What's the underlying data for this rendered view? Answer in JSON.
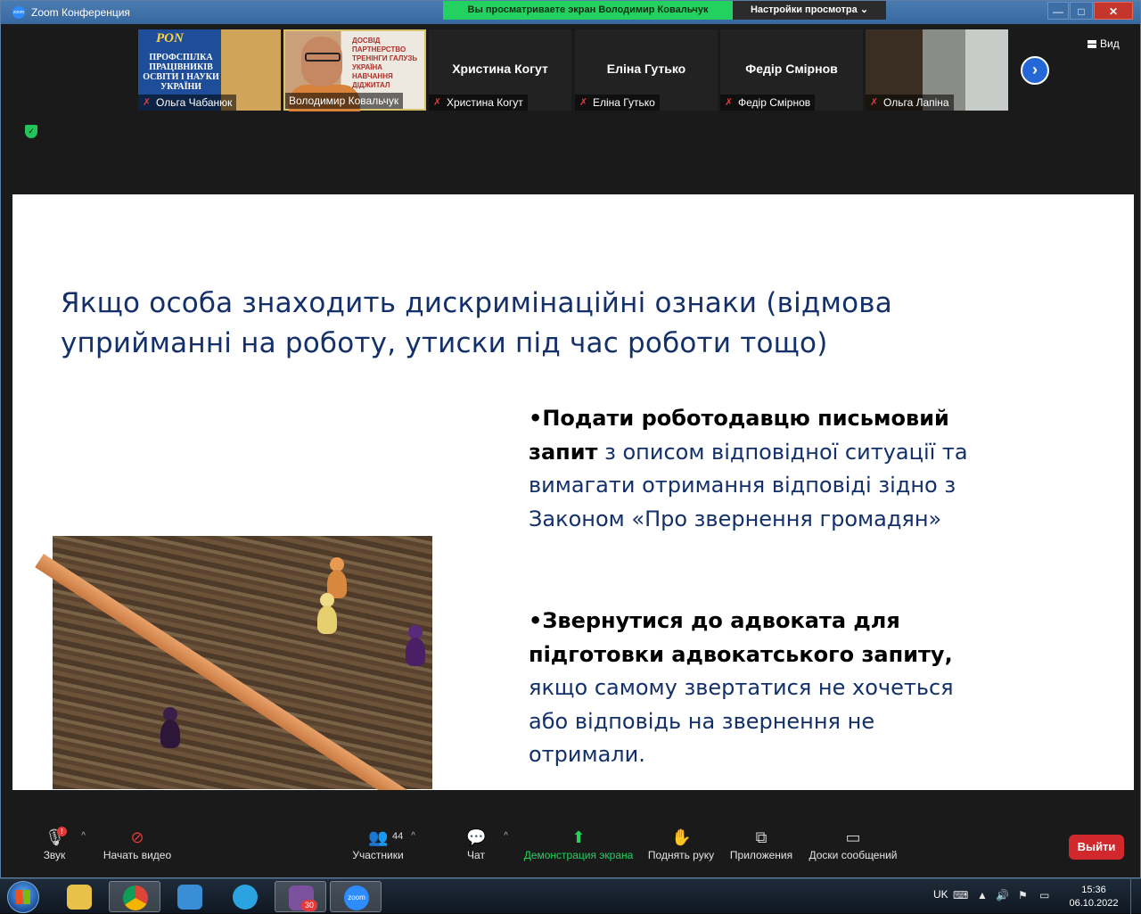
{
  "window": {
    "title": "Zoom Конференция",
    "share_banner": "Вы просматриваете экран Володимир Ковальчук",
    "view_settings": "Настройки просмотра",
    "view_button": "Вид"
  },
  "participants": [
    {
      "name": "Ольга Чабанюк",
      "muted": true,
      "video": true
    },
    {
      "name": "Володимир Ковальчук",
      "muted": false,
      "video": true
    },
    {
      "name": "Христина Когут",
      "muted": true,
      "video": false
    },
    {
      "name": "Еліна Гутько",
      "muted": true,
      "video": false
    },
    {
      "name": "Федір Смірнов",
      "muted": true,
      "video": false
    },
    {
      "name": "Ольга Лапіна",
      "muted": true,
      "video": true
    }
  ],
  "tile1_poster": {
    "logo": "PON",
    "lines": [
      "ПРОФСПІЛКА",
      "ПРАЦІВНИКІВ",
      "ОСВІТИ І НАУКИ",
      "УКРАЇНИ"
    ]
  },
  "slide": {
    "title": "Якщо особа знаходить дискримінаційні ознаки (відмова уприйманні на роботу, утиски під час роботи тощо)",
    "bullet1_bold": "•Подати роботодавцю письмовий запит",
    "bullet1_rest": " з описом відповідної ситуації та вимагати отримання відповіді зідно з Законом «Про звернення громадян»",
    "bullet2_bold": "•Звернутися до адвоката для підготовки адвокатського запиту,",
    "bullet2_rest": " якщо самому звертатися не хочеться або відповідь на звернення не отримали."
  },
  "toolbar": {
    "audio": "Звук",
    "video": "Начать видео",
    "participants": "Участники",
    "participants_count": "44",
    "chat": "Чат",
    "share": "Демонстрация экрана",
    "raise_hand": "Поднять руку",
    "apps": "Приложения",
    "whiteboards": "Доски сообщений",
    "leave": "Выйти"
  },
  "taskbar": {
    "viber_badge": "30",
    "zoom_label": "zoom",
    "lang": "UK",
    "time": "15:36",
    "date": "06.10.2022"
  }
}
